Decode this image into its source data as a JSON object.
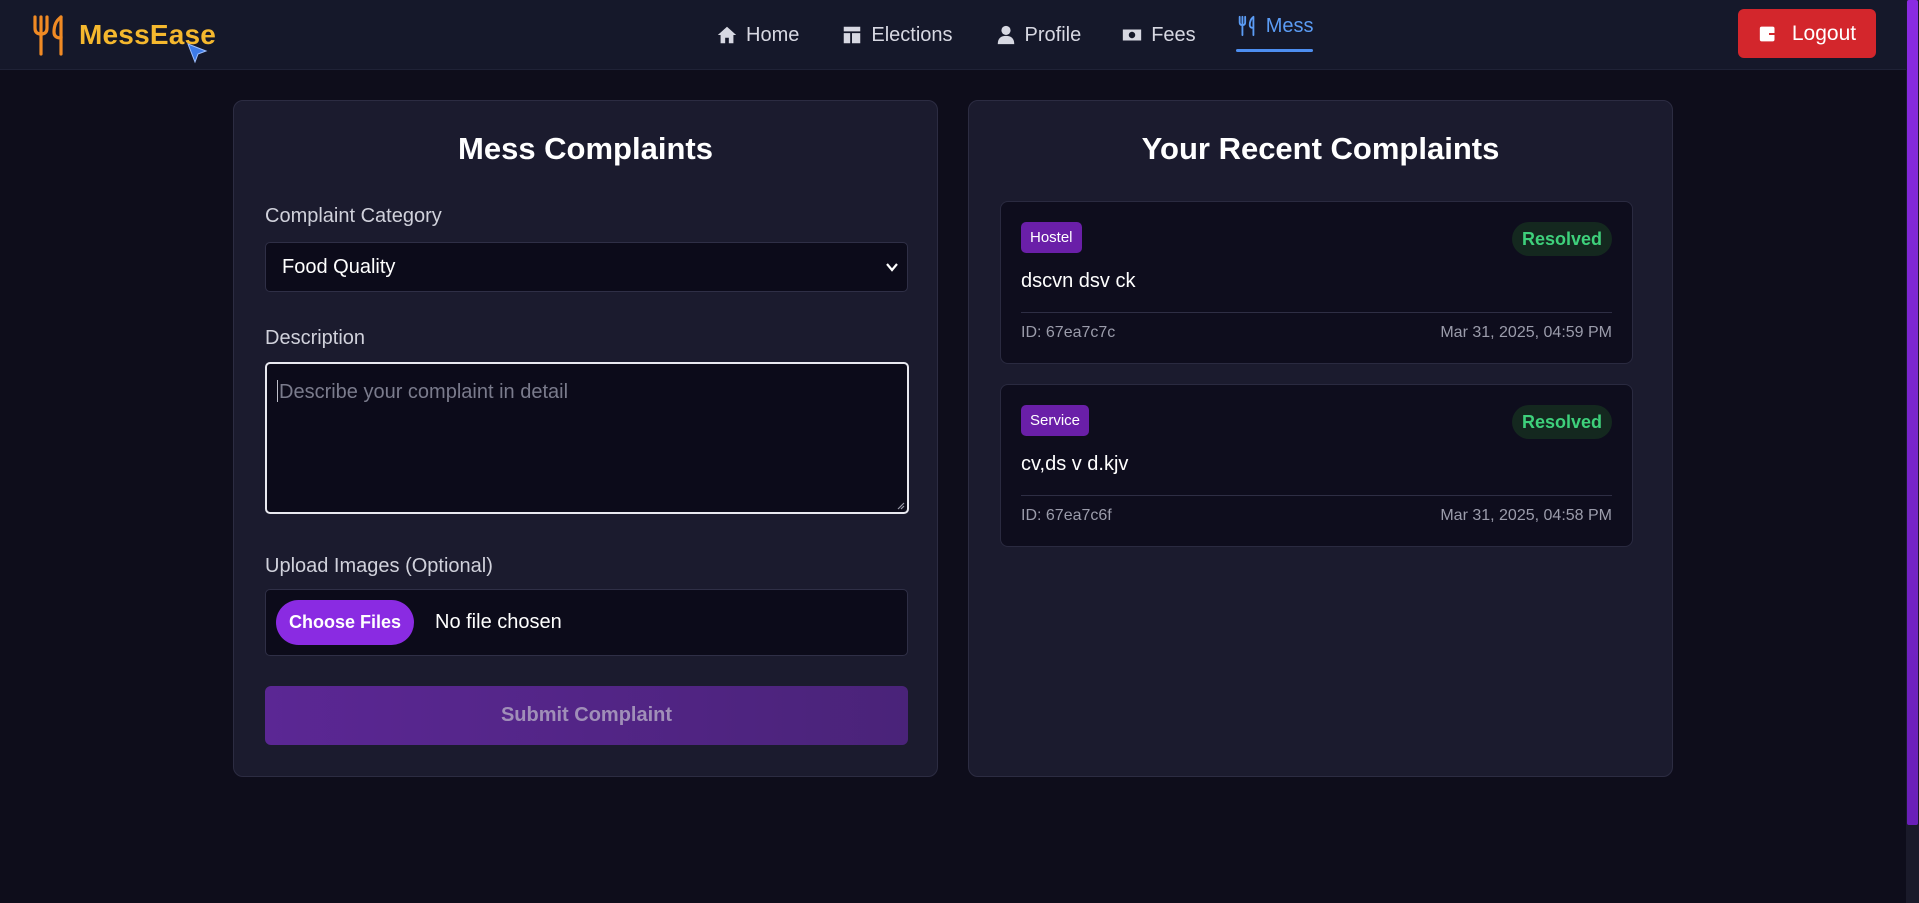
{
  "app": {
    "brand_name": "MessEase",
    "accent_color": "#f5b82e"
  },
  "nav": {
    "items": [
      {
        "label": "Home",
        "icon": "home-icon"
      },
      {
        "label": "Elections",
        "icon": "elections-icon"
      },
      {
        "label": "Profile",
        "icon": "user-icon"
      },
      {
        "label": "Fees",
        "icon": "money-icon"
      },
      {
        "label": "Mess",
        "icon": "utensils-icon",
        "active": true
      }
    ],
    "logout_label": "Logout"
  },
  "form": {
    "title": "Mess Complaints",
    "category_label": "Complaint Category",
    "category_value": "Food Quality",
    "description_label": "Description",
    "description_placeholder": "Describe your complaint in detail",
    "upload_label": "Upload Images (Optional)",
    "choose_files_label": "Choose Files",
    "no_file_text": "No file chosen",
    "submit_label": "Submit Complaint"
  },
  "recent": {
    "title": "Your Recent Complaints",
    "complaints": [
      {
        "category": "Hostel",
        "status": "Resolved",
        "text": "dscvn dsv ck",
        "id": "ID: 67ea7c7c",
        "date": "Mar 31, 2025, 04:59 PM"
      },
      {
        "category": "Service",
        "status": "Resolved",
        "text": "cv,ds v d.kjv",
        "id": "ID: 67ea7c6f",
        "date": "Mar 31, 2025, 04:58 PM"
      }
    ]
  }
}
